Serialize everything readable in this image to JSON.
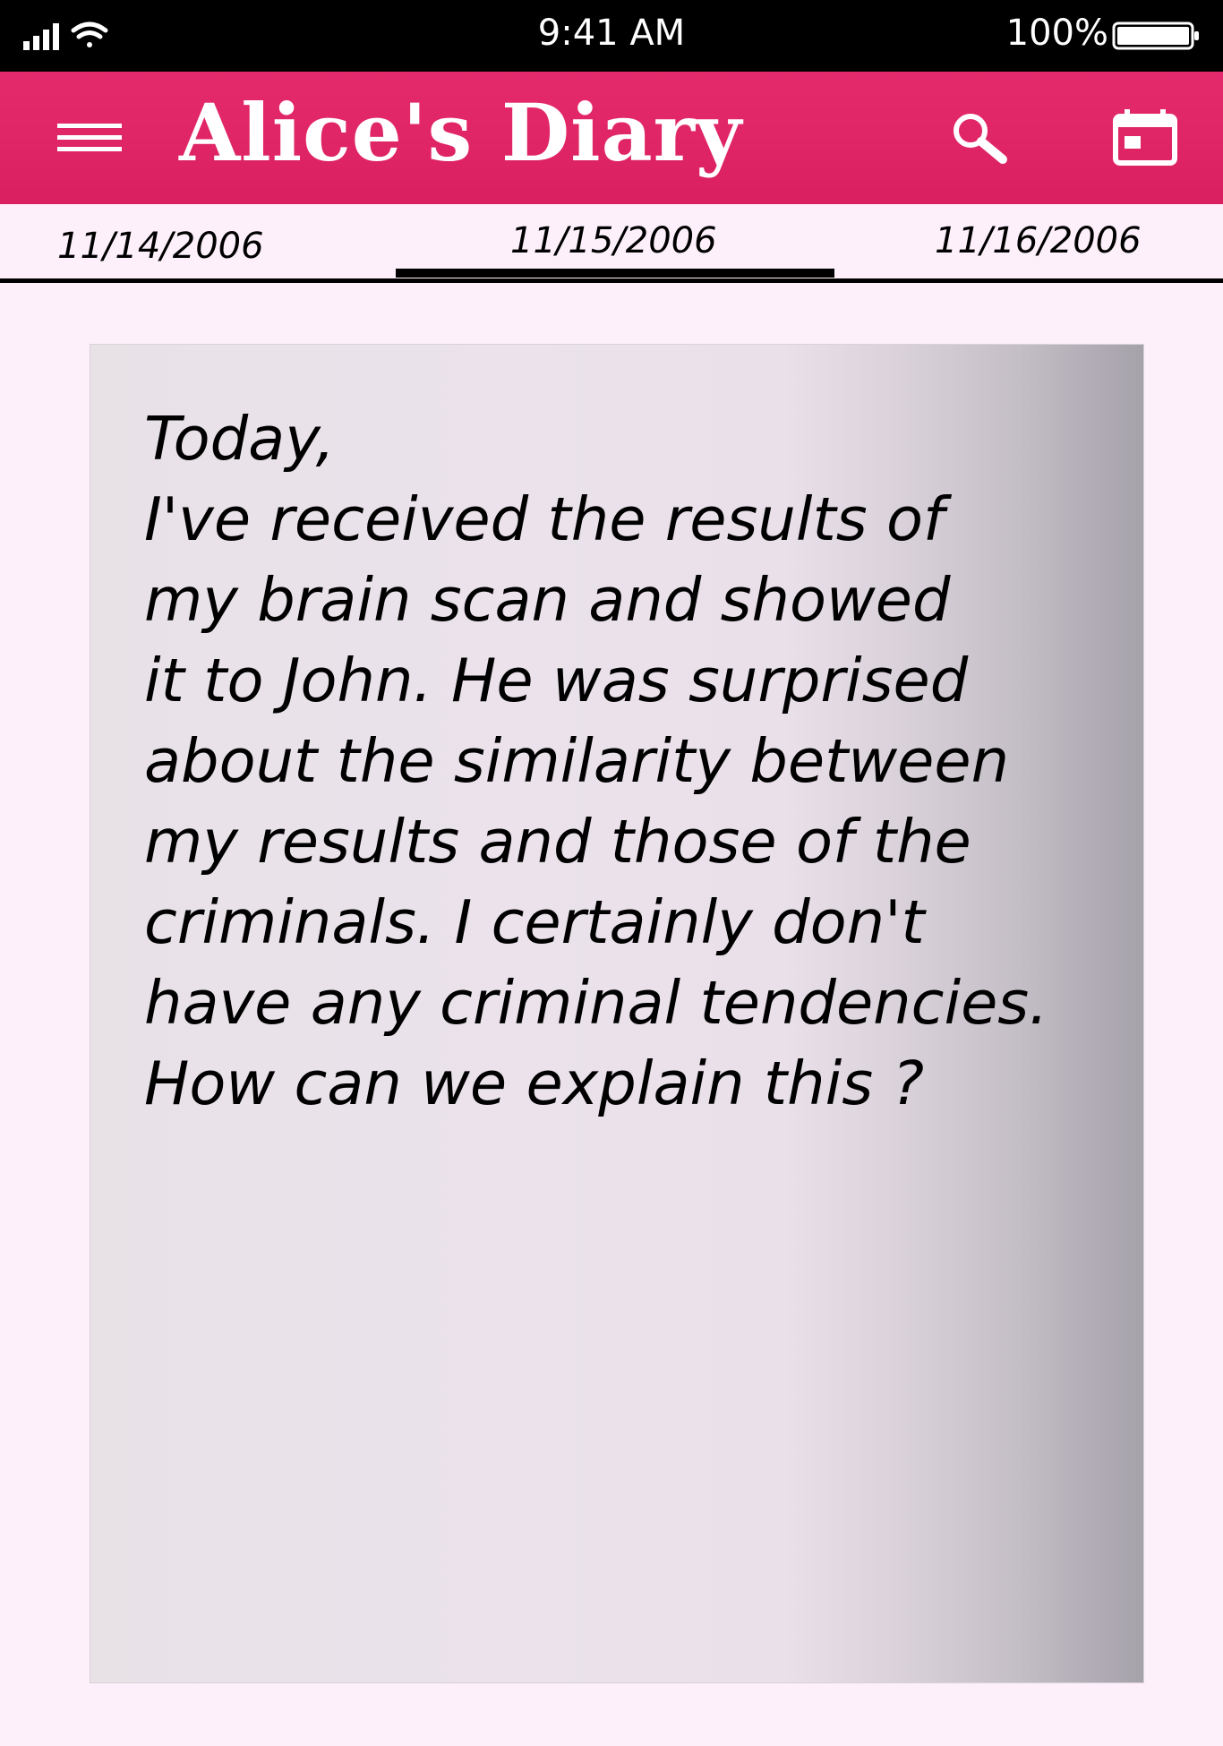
{
  "status_bar": {
    "time": "9:41 AM",
    "battery": "100%",
    "signal_icon": "cellular-signal-icon",
    "wifi_icon": "wifi-icon",
    "battery_icon": "battery-full-icon"
  },
  "app_bar": {
    "title": "Alice's Diary",
    "menu_icon": "hamburger-menu-icon",
    "search_icon": "search-icon",
    "calendar_icon": "calendar-icon",
    "background_color": "#e52a6c"
  },
  "date_tabs": {
    "prev": "11/14/2006",
    "current": "11/15/2006",
    "next": "11/16/2006",
    "active_index": 1
  },
  "entry": {
    "lines": [
      "Today,",
      "I've received the results of",
      "my brain scan and showed",
      "it to John. He was surprised",
      "about the similarity between",
      "my results and those of the",
      "criminals. I certainly don't",
      "have any criminal tendencies.",
      "How can we explain this ?"
    ]
  },
  "colors": {
    "page_background": "#fdf0fb",
    "status_bar": "#000000",
    "accent": "#e52a6c"
  }
}
